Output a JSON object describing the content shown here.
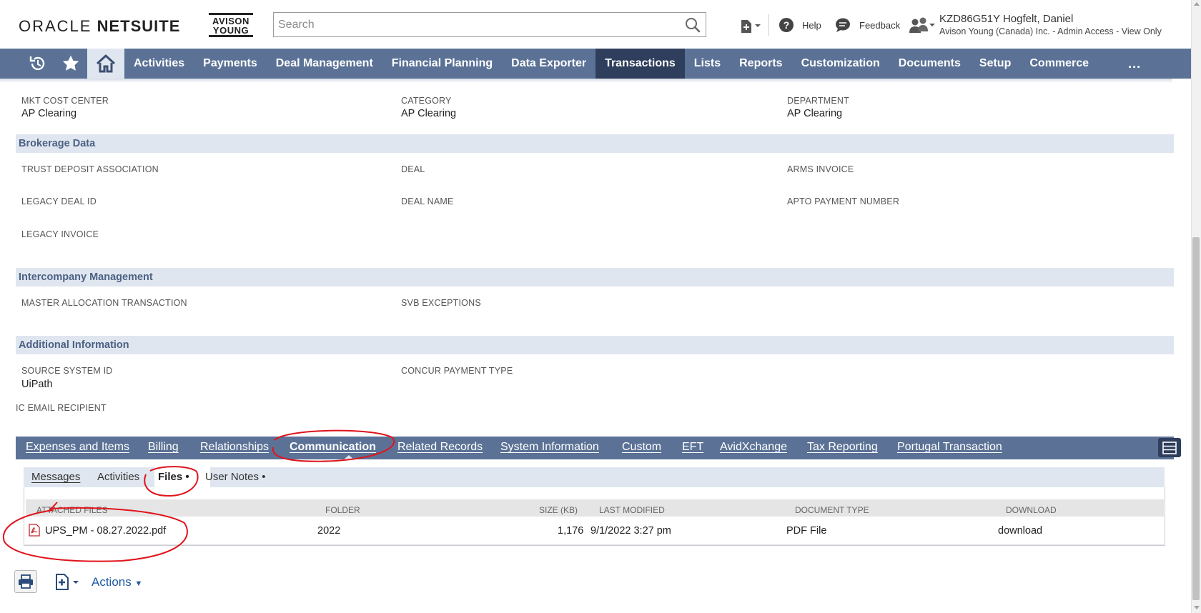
{
  "header": {
    "logo_word1": "ORACLE",
    "logo_word2": "NETSUITE",
    "brand_line1": "AVISON",
    "brand_line2": "YOUNG",
    "search_placeholder": "Search",
    "help_label": "Help",
    "feedback_label": "Feedback",
    "user_name": "KZD86G51Y Hogfelt, Daniel",
    "user_role": "Avison Young (Canada) Inc. - Admin Access - View Only"
  },
  "nav": {
    "items": [
      {
        "label": "Activities",
        "active": false
      },
      {
        "label": "Payments",
        "active": false
      },
      {
        "label": "Deal Management",
        "active": false
      },
      {
        "label": "Financial Planning",
        "active": false
      },
      {
        "label": "Data Exporter",
        "active": false
      },
      {
        "label": "Transactions",
        "active": true
      },
      {
        "label": "Lists",
        "active": false
      },
      {
        "label": "Reports",
        "active": false
      },
      {
        "label": "Customization",
        "active": false
      },
      {
        "label": "Documents",
        "active": false
      },
      {
        "label": "Setup",
        "active": false
      },
      {
        "label": "Commerce",
        "active": false
      }
    ],
    "more_label": "..."
  },
  "classification": {
    "fields": [
      {
        "label": "MKT COST CENTER",
        "value": "AP Clearing"
      },
      {
        "label": "CATEGORY",
        "value": "AP Clearing"
      },
      {
        "label": "DEPARTMENT",
        "value": "AP Clearing"
      }
    ]
  },
  "brokerage": {
    "title": "Brokerage Data",
    "fields": [
      {
        "label": "TRUST DEPOSIT ASSOCIATION"
      },
      {
        "label": "DEAL"
      },
      {
        "label": "ARMS INVOICE"
      },
      {
        "label": "LEGACY DEAL ID"
      },
      {
        "label": "DEAL NAME"
      },
      {
        "label": "APTO PAYMENT NUMBER"
      },
      {
        "label": "LEGACY INVOICE"
      }
    ]
  },
  "intercompany": {
    "title": "Intercompany Management",
    "fields": [
      {
        "label": "MASTER ALLOCATION TRANSACTION"
      },
      {
        "label": "SVB EXCEPTIONS"
      }
    ]
  },
  "additional": {
    "title": "Additional Information",
    "fields": [
      {
        "label": "SOURCE SYSTEM ID",
        "value": "UiPath"
      },
      {
        "label": "CONCUR PAYMENT TYPE"
      },
      {
        "label": "IC EMAIL RECIPIENT"
      }
    ]
  },
  "tabs": [
    {
      "label": "Expenses and Items",
      "active": false
    },
    {
      "label": "Billing",
      "active": false
    },
    {
      "label": "Relationships",
      "active": false
    },
    {
      "label": "Communication",
      "active": true
    },
    {
      "label": "Related Records",
      "active": false
    },
    {
      "label": "System Information",
      "active": false
    },
    {
      "label": "Custom",
      "active": false
    },
    {
      "label": "EFT",
      "active": false
    },
    {
      "label": "AvidXchange",
      "active": false
    },
    {
      "label": "Tax Reporting",
      "active": false
    },
    {
      "label": "Portugal Transaction",
      "active": false
    }
  ],
  "subtabs": [
    {
      "label": "Messages",
      "active": false
    },
    {
      "label": "Activities",
      "active": false
    },
    {
      "label": "Files •",
      "active": true
    },
    {
      "label": "User Notes •",
      "active": false
    }
  ],
  "files_table": {
    "headers": [
      "ATTACHED FILES",
      "FOLDER",
      "SIZE (KB)",
      "LAST MODIFIED",
      "DOCUMENT TYPE",
      "DOWNLOAD"
    ],
    "rows": [
      {
        "name": "UPS_PM - 08.27.2022.pdf",
        "folder": "2022",
        "size": "1,176",
        "modified": "9/1/2022 3:27 pm",
        "type": "PDF File",
        "download": "download"
      }
    ]
  },
  "bottom": {
    "actions_label": "Actions"
  },
  "colors": {
    "nav_bg": "#5b7296",
    "nav_active": "#2e3e5c",
    "section_bg": "#dfe6ef",
    "section_text": "#4d6185",
    "link": "#1f5aa0",
    "annotation": "#e0141b"
  }
}
